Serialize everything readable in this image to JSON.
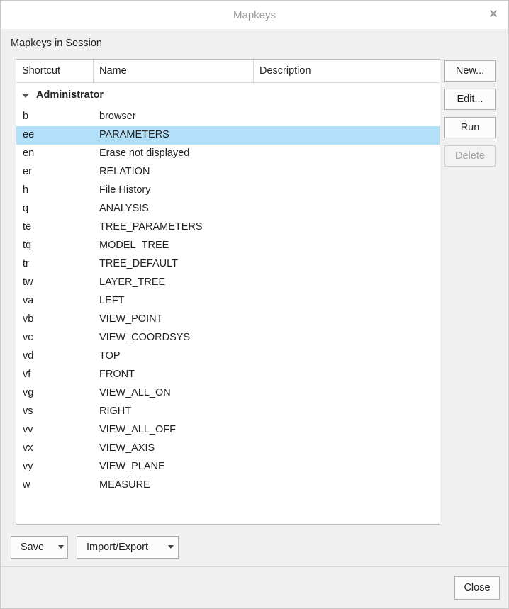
{
  "window": {
    "title": "Mapkeys"
  },
  "section_label": "Mapkeys in Session",
  "table": {
    "columns": [
      "Shortcut",
      "Name",
      "Description"
    ],
    "group": "Administrator",
    "rows": [
      {
        "shortcut": "b",
        "name": "browser"
      },
      {
        "shortcut": "ee",
        "name": "PARAMETERS",
        "selected": true
      },
      {
        "shortcut": "en",
        "name": "Erase not displayed"
      },
      {
        "shortcut": "er",
        "name": "RELATION"
      },
      {
        "shortcut": "h",
        "name": "File History"
      },
      {
        "shortcut": "q",
        "name": "ANALYSIS"
      },
      {
        "shortcut": "te",
        "name": "TREE_PARAMETERS"
      },
      {
        "shortcut": "tq",
        "name": "MODEL_TREE"
      },
      {
        "shortcut": "tr",
        "name": "TREE_DEFAULT"
      },
      {
        "shortcut": "tw",
        "name": "LAYER_TREE"
      },
      {
        "shortcut": "va",
        "name": "LEFT"
      },
      {
        "shortcut": "vb",
        "name": "VIEW_POINT"
      },
      {
        "shortcut": "vc",
        "name": "VIEW_COORDSYS"
      },
      {
        "shortcut": "vd",
        "name": "TOP"
      },
      {
        "shortcut": "vf",
        "name": "FRONT"
      },
      {
        "shortcut": "vg",
        "name": "VIEW_ALL_ON"
      },
      {
        "shortcut": "vs",
        "name": "RIGHT"
      },
      {
        "shortcut": "vv",
        "name": "VIEW_ALL_OFF"
      },
      {
        "shortcut": "vx",
        "name": "VIEW_AXIS"
      },
      {
        "shortcut": "vy",
        "name": "VIEW_PLANE"
      },
      {
        "shortcut": "w",
        "name": "MEASURE"
      }
    ]
  },
  "buttons": {
    "new": "New...",
    "edit": "Edit...",
    "run": "Run",
    "delete": "Delete",
    "save": "Save",
    "import_export": "Import/Export",
    "close": "Close"
  },
  "colors": {
    "selection": "#b3e0f9"
  },
  "icons": {
    "close": "close-icon",
    "group_toggle": "triangle-down-icon",
    "dropdown": "chevron-down-icon"
  }
}
